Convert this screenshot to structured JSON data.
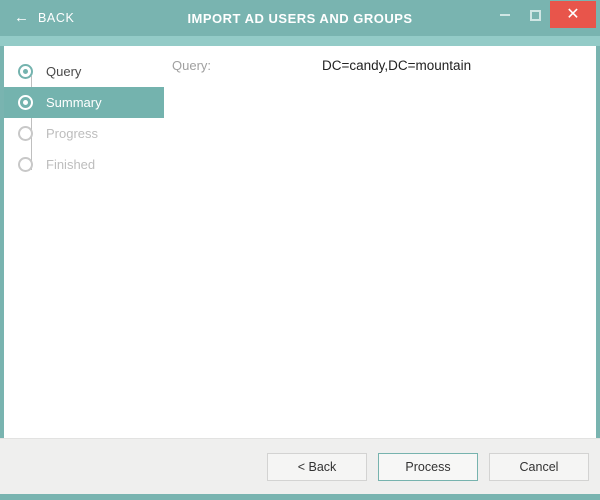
{
  "titlebar": {
    "back_label": "BACK",
    "back_icon": "arrow-left-icon",
    "title": "IMPORT AD USERS AND GROUPS",
    "minimize_icon": "minimize-icon",
    "maximize_icon": "maximize-icon",
    "close_icon": "close-icon",
    "close_glyph": "✕",
    "arrow_glyph": "←",
    "bar_color": "#79b4b0",
    "strip_color": "#93cbc7",
    "close_color": "#e8554b"
  },
  "steps": {
    "items": [
      {
        "label": "Query",
        "state": "done"
      },
      {
        "label": "Summary",
        "state": "active"
      },
      {
        "label": "Progress",
        "state": "todo"
      },
      {
        "label": "Finished",
        "state": "todo"
      }
    ],
    "active_color": "#74b3ae"
  },
  "panel": {
    "fields": [
      {
        "label": "Query:",
        "value": "DC=candy,DC=mountain"
      }
    ]
  },
  "footer": {
    "buttons": [
      {
        "label": "< Back",
        "primary": false
      },
      {
        "label": "Process",
        "primary": true
      },
      {
        "label": "Cancel",
        "primary": false
      }
    ]
  }
}
